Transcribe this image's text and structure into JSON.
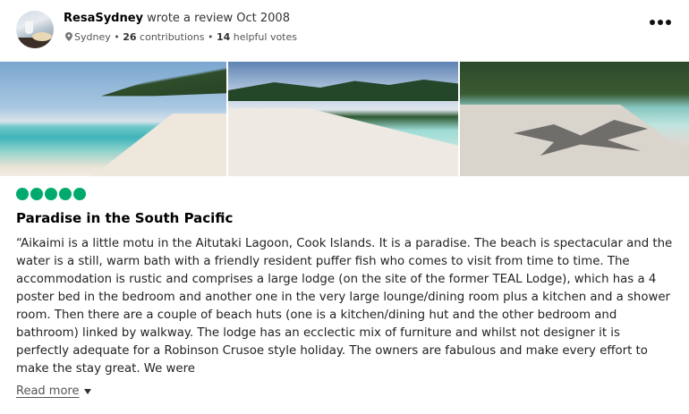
{
  "review": {
    "author": "ResaSydney",
    "wrote_text": "wrote a review Oct 2008",
    "location": "Sydney",
    "contributions_count": "26",
    "contributions_label": "contributions",
    "helpful_count": "14",
    "helpful_label": "helpful votes",
    "separator": "•",
    "rating": 5,
    "title": "Paradise in the South Pacific",
    "text": "“Aikaimi is a little motu in the Aitutaki Lagoon, Cook Islands. It is a paradise. The beach is spectacular and the water is a still, warm bath with a friendly resident puffer fish who comes to visit from time to time. The accommodation is rustic and comprises a large lodge (on the site of the former TEAL Lodge), which has a 4 poster bed in the bedroom and another one in the very large lounge/dining room plus a kitchen and a shower room. Then there are a couple of beach huts (one is a kitchen/dining hut and the other bedroom and bathroom) linked by walkway. The lodge has an ecclectic mix of furniture and whilst not designer it is perfectly adequate for a Robinson Crusoe style holiday. The owners are fabulous and make every effort to make the stay great. We were",
    "read_more": "Read more"
  },
  "colors": {
    "rating_bubble": "#00aa6c"
  },
  "icons": {
    "location": "map-pin-icon",
    "menu": "more-options-icon",
    "expand": "caret-down-icon"
  }
}
